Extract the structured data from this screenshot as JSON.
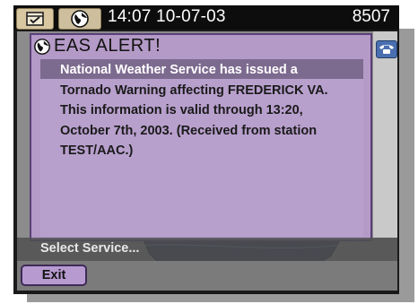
{
  "status_bar": {
    "time_date": "14:07 10-07-03",
    "number": "8507",
    "icons": [
      "checklist-icon",
      "globe-icon"
    ]
  },
  "alert": {
    "title": "EAS ALERT!",
    "icon": "globe-icon",
    "lines": [
      "National Weather Service has issued a",
      "Tornado Warning affecting FREDERICK VA.",
      "This information is valid through 13:20,",
      "October 7th, 2003. (Received from station",
      "TEST/AAC.)"
    ]
  },
  "side_button": {
    "icon": "phone-icon"
  },
  "footer": {
    "select_label": "Select Service...",
    "exit_label": "Exit"
  },
  "colors": {
    "panel": "#b49ac7",
    "highlight": "#7d6a8f",
    "exit_button": "#b79bd0",
    "phone_button": "#4a6fb1"
  }
}
